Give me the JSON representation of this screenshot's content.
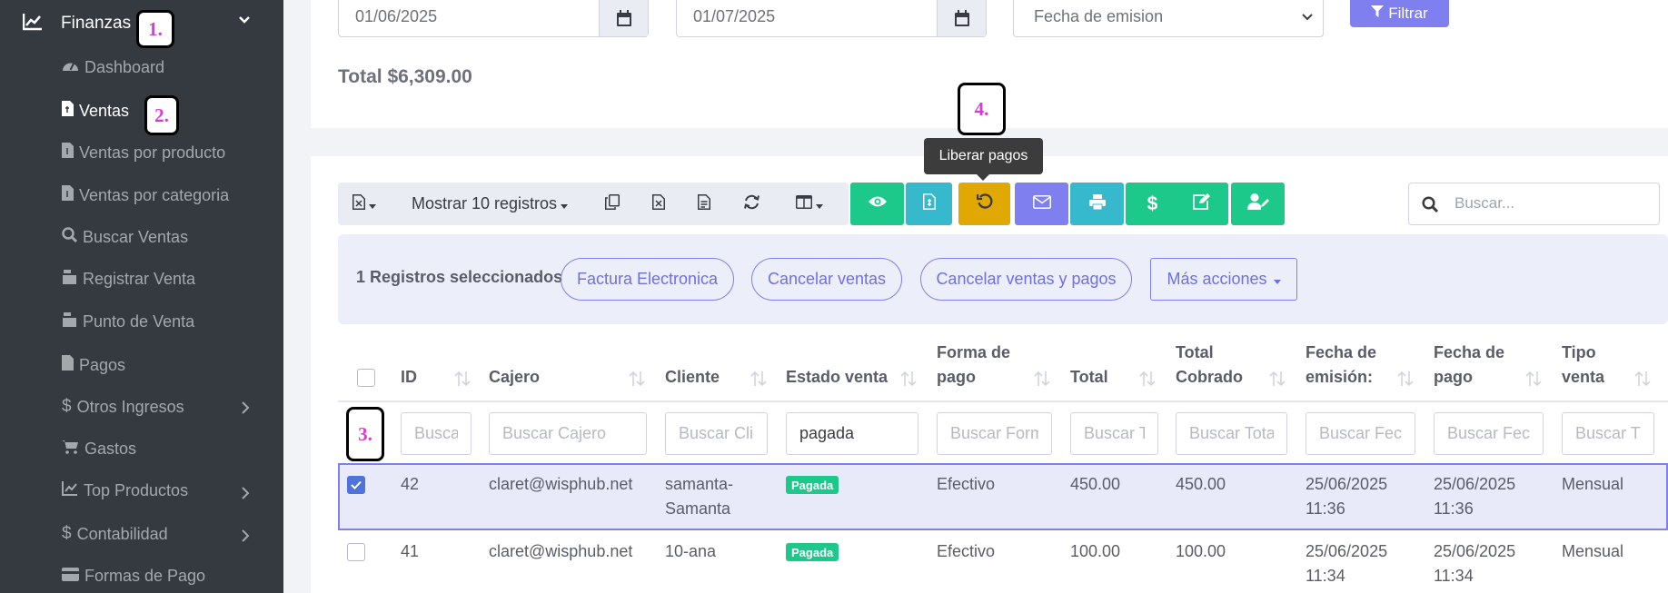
{
  "sidebar": {
    "section_title": "Finanzas",
    "items": [
      {
        "label": "Dashboard",
        "icon": "gauge-icon"
      },
      {
        "label": "Ventas",
        "icon": "file-invoice-icon",
        "active": true
      },
      {
        "label": "Ventas por producto",
        "icon": "file-invoice-icon"
      },
      {
        "label": "Ventas por categoria",
        "icon": "file-invoice-icon"
      },
      {
        "label": "Buscar Ventas",
        "icon": "search-icon"
      },
      {
        "label": "Registrar Venta",
        "icon": "cash-register-icon"
      },
      {
        "label": "Punto de Venta",
        "icon": "cash-register-icon"
      },
      {
        "label": "Pagos",
        "icon": "file-icon"
      },
      {
        "label": "Otros Ingresos",
        "icon": "dollar-icon",
        "submenu": true
      },
      {
        "label": "Gastos",
        "icon": "cart-icon"
      },
      {
        "label": "Top Productos",
        "icon": "chart-line-icon",
        "submenu": true
      },
      {
        "label": "Contabilidad",
        "icon": "dollar-icon",
        "submenu": true
      },
      {
        "label": "Formas de Pago",
        "icon": "credit-card-icon"
      }
    ]
  },
  "filters": {
    "date_from": "01/06/2025",
    "date_to": "01/07/2025",
    "date_type": "Fecha de emision",
    "filter_button": "Filtrar",
    "total": "Total $6,309.00"
  },
  "toolbar": {
    "show_records": "Mostrar 10 registros",
    "tooltip": "Liberar pagos",
    "search_placeholder": "Buscar..."
  },
  "selection": {
    "text": "1 Registros seleccionados",
    "buttons": [
      "Factura Electronica",
      "Cancelar ventas",
      "Cancelar ventas y pagos"
    ],
    "more_actions": "Más acciones"
  },
  "table": {
    "headers": {
      "id": "ID",
      "cajero": "Cajero",
      "cliente": "Cliente",
      "estado": "Estado venta",
      "forma_1": "Forma de",
      "forma_2": "pago",
      "total": "Total",
      "cobrado_1": "Total",
      "cobrado_2": "Cobrado",
      "emision_1": "Fecha de",
      "emision_2": "emisión:",
      "pago_1": "Fecha de",
      "pago_2": "pago",
      "tipo_1": "Tipo",
      "tipo_2": "venta"
    },
    "filter_placeholders": {
      "id": "Buscar ID",
      "cajero": "Buscar Cajero",
      "cliente": "Buscar Cliente",
      "estado_value": "pagada",
      "forma": "Buscar Forma de pago",
      "total": "Buscar Total",
      "cobrado": "Buscar Total Cobrado",
      "emision": "Buscar Fecha de emisión",
      "pago": "Buscar Fecha de pago",
      "tipo": "Buscar Tipo venta"
    },
    "rows": [
      {
        "id": "42",
        "cajero": "claret@wisphub.net",
        "cliente_1": "samanta-",
        "cliente_2": "Samanta",
        "estado": "Pagada",
        "forma": "Efectivo",
        "total": "450.00",
        "cobrado": "450.00",
        "emision_1": "25/06/2025",
        "emision_2": "11:36",
        "pago_1": "25/06/2025",
        "pago_2": "11:36",
        "tipo": "Mensual",
        "selected": true
      },
      {
        "id": "41",
        "cajero": "claret@wisphub.net",
        "cliente_1": "10-ana",
        "cliente_2": "",
        "estado": "Pagada",
        "forma": "Efectivo",
        "total": "100.00",
        "cobrado": "100.00",
        "emision_1": "25/06/2025",
        "emision_2": "11:34",
        "pago_1": "25/06/2025",
        "pago_2": "11:34",
        "tipo": "Mensual",
        "selected": false
      }
    ]
  },
  "markers": [
    "1.",
    "2.",
    "3.",
    "4."
  ],
  "colors": {
    "sidebar_bg": "#343a40",
    "primary": "#7f7fef",
    "success": "#1cc88a",
    "info": "#36b9cc",
    "warning": "#e0a800",
    "marker_text": "#d63bd6"
  }
}
